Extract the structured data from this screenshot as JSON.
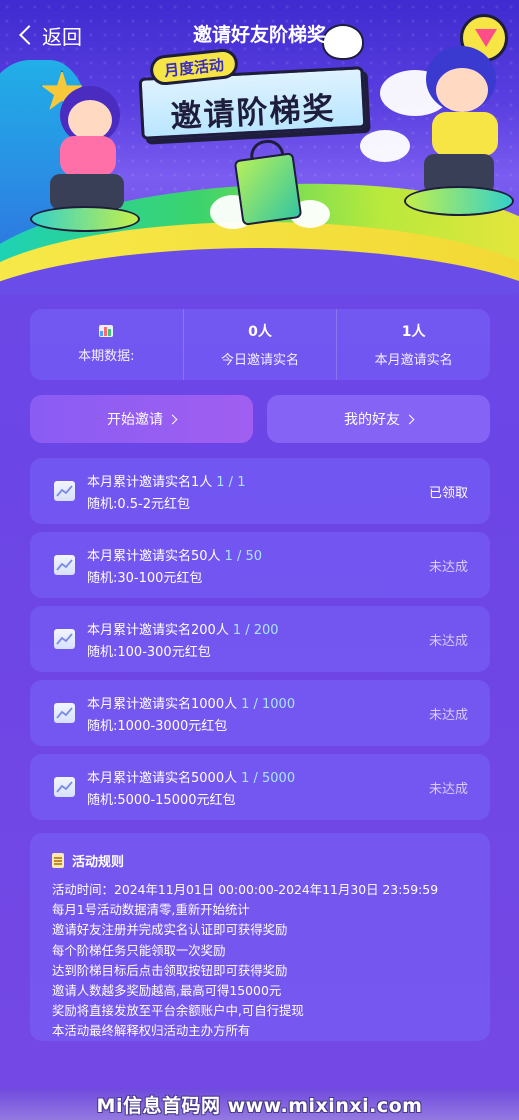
{
  "nav": {
    "back_label": "返回",
    "title": "邀请好友阶梯奖"
  },
  "banner": {
    "tag": "月度活动",
    "headline": "邀请阶梯奖"
  },
  "stats": {
    "period_icon": "bar-chart-icon",
    "period_label": "本期数据:",
    "today_value": "0人",
    "today_label": "今日邀请实名",
    "month_value": "1人",
    "month_label": "本月邀请实名"
  },
  "buttons": {
    "invite": "开始邀请",
    "friends": "我的好友"
  },
  "tiers": [
    {
      "title": "本月累计邀请实名1人",
      "progress": "1 / 1",
      "reward": "随机:0.5-2元红包",
      "status": "已领取",
      "done": true
    },
    {
      "title": "本月累计邀请实名50人",
      "progress": "1 / 50",
      "reward": "随机:30-100元红包",
      "status": "未达成",
      "done": false
    },
    {
      "title": "本月累计邀请实名200人",
      "progress": "1 / 200",
      "reward": "随机:100-300元红包",
      "status": "未达成",
      "done": false
    },
    {
      "title": "本月累计邀请实名1000人",
      "progress": "1 / 1000",
      "reward": "随机:1000-3000元红包",
      "status": "未达成",
      "done": false
    },
    {
      "title": "本月累计邀请实名5000人",
      "progress": "1 / 5000",
      "reward": "随机:5000-15000元红包",
      "status": "未达成",
      "done": false
    }
  ],
  "rules": {
    "title": "活动规则",
    "lines": [
      "活动时间：2024年11月01日 00:00:00-2024年11月30日 23:59:59",
      "每月1号活动数据清零,重新开始统计",
      "邀请好友注册并完成实名认证即可获得奖励",
      "每个阶梯任务只能领取一次奖励",
      "达到阶梯目标后点击领取按钮即可获得奖励",
      "邀请人数越多奖励越高,最高可得15000元",
      "奖励将直接发放至平台余额账户中,可自行提现",
      "本活动最终解释权归活动主办方所有"
    ]
  },
  "watermark": "Mi信息首码网 www.mixinxi.com",
  "colors": {
    "background": "#6a4ce8",
    "card": "#7a64fa",
    "progress_text": "#a8e6ff",
    "pending_text": "#d6cdfa"
  }
}
